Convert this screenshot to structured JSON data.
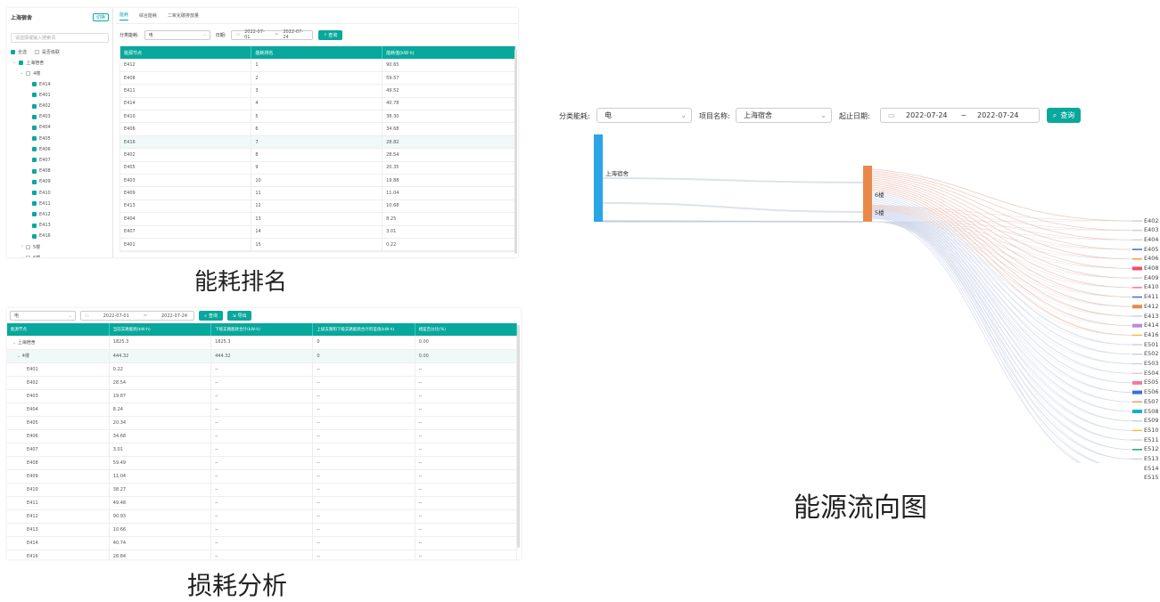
{
  "captions": {
    "ranking": "能耗排名",
    "loss": "损耗分析",
    "flow": "能源流向图"
  },
  "ranking_panel": {
    "org_title": "上海宿舍",
    "switch_btn": "切换",
    "search_placeholder": "请选择或输入搜索词",
    "select_all": "全选",
    "cascade": "是否级联",
    "tree_root": "上海宿舍",
    "floor4": "4楼",
    "floor4_rooms": [
      "E414",
      "E401",
      "E402",
      "E403",
      "E404",
      "E405",
      "E406",
      "E407",
      "E408",
      "E409",
      "E410",
      "E411",
      "E412",
      "E413",
      "E416"
    ],
    "floor5": "5楼",
    "floor6": "6楼",
    "tabs": [
      "能耗",
      "综合能耗",
      "二氧化碳排放量"
    ],
    "filter_label": "分类能耗:",
    "filter_value": "电",
    "date_label": "日期:",
    "date_from": "2022-07-01",
    "date_sep": "~",
    "date_to": "2022-07-24",
    "query_btn": "查询",
    "columns": [
      "能源节点",
      "能耗排名",
      "能耗值(kW·h)"
    ],
    "rows": [
      [
        "E412",
        "1",
        "90.65"
      ],
      [
        "E408",
        "2",
        "59.57"
      ],
      [
        "E411",
        "3",
        "49.52"
      ],
      [
        "E414",
        "4",
        "40.78"
      ],
      [
        "E410",
        "5",
        "38.30"
      ],
      [
        "E406",
        "6",
        "34.68"
      ],
      [
        "E416",
        "7",
        "28.82"
      ],
      [
        "E402",
        "8",
        "28.54"
      ],
      [
        "E405",
        "9",
        "20.35"
      ],
      [
        "E403",
        "10",
        "19.88"
      ],
      [
        "E409",
        "11",
        "11.04"
      ],
      [
        "E413",
        "12",
        "10.68"
      ],
      [
        "E404",
        "13",
        "8.25"
      ],
      [
        "E407",
        "14",
        "3.01"
      ],
      [
        "E401",
        "15",
        "0.22"
      ]
    ]
  },
  "loss_panel": {
    "filter_value": "电",
    "date_from": "2022-07-01",
    "date_sep": "~",
    "date_to": "2022-07-24",
    "query_btn": "查询",
    "export_btn": "导出",
    "columns": [
      "能源节点",
      "当前支路能耗(kW·h)",
      "下级支路能耗合计(kW·h)",
      "上级支路和下级支路能耗合计的差值(kW·h)",
      "相差百分比(%)"
    ],
    "rows": [
      [
        "上海宿舍",
        "1825.3",
        "1825.3",
        "0",
        "0.00"
      ],
      [
        "4楼",
        "444.32",
        "444.32",
        "0",
        "0.00"
      ],
      [
        "E401",
        "0.22",
        "--",
        "--",
        "--"
      ],
      [
        "E402",
        "28.54",
        "--",
        "--",
        "--"
      ],
      [
        "E403",
        "19.87",
        "--",
        "--",
        "--"
      ],
      [
        "E404",
        "8.24",
        "--",
        "--",
        "--"
      ],
      [
        "E405",
        "20.34",
        "--",
        "--",
        "--"
      ],
      [
        "E406",
        "34.68",
        "--",
        "--",
        "--"
      ],
      [
        "E407",
        "3.01",
        "--",
        "--",
        "--"
      ],
      [
        "E408",
        "59.49",
        "--",
        "--",
        "--"
      ],
      [
        "E409",
        "11.04",
        "--",
        "--",
        "--"
      ],
      [
        "E410",
        "38.27",
        "--",
        "--",
        "--"
      ],
      [
        "E411",
        "49.48",
        "--",
        "--",
        "--"
      ],
      [
        "E412",
        "90.93",
        "--",
        "--",
        "--"
      ],
      [
        "E413",
        "10.66",
        "--",
        "--",
        "--"
      ],
      [
        "E414",
        "40.74",
        "--",
        "--",
        "--"
      ],
      [
        "E416",
        "28.84",
        "--",
        "--",
        "--"
      ]
    ]
  },
  "flow_panel": {
    "filter_label": "分类能耗:",
    "filter_value": "电",
    "project_label": "项目名称:",
    "project_value": "上海宿舍",
    "date_label": "起止日期:",
    "date_from": "2022-07-24",
    "date_sep": "~",
    "date_to": "2022-07-24",
    "query_btn": "查询",
    "root_node": "上海宿舍",
    "node_6": "6楼",
    "node_5": "5楼",
    "leaves": [
      "E402",
      "E403",
      "E404",
      "E405",
      "E406",
      "E408",
      "E409",
      "E410",
      "E411",
      "E412",
      "E413",
      "E414",
      "E416",
      "E501",
      "E502",
      "E503",
      "E504",
      "E505",
      "E506",
      "E507",
      "E508",
      "E509",
      "E510",
      "E511",
      "E512",
      "E513",
      "E514",
      "E515"
    ],
    "colors": {
      "accent": "#08a89c",
      "root": "#2aa5e6",
      "mid": "#e8894a"
    }
  }
}
